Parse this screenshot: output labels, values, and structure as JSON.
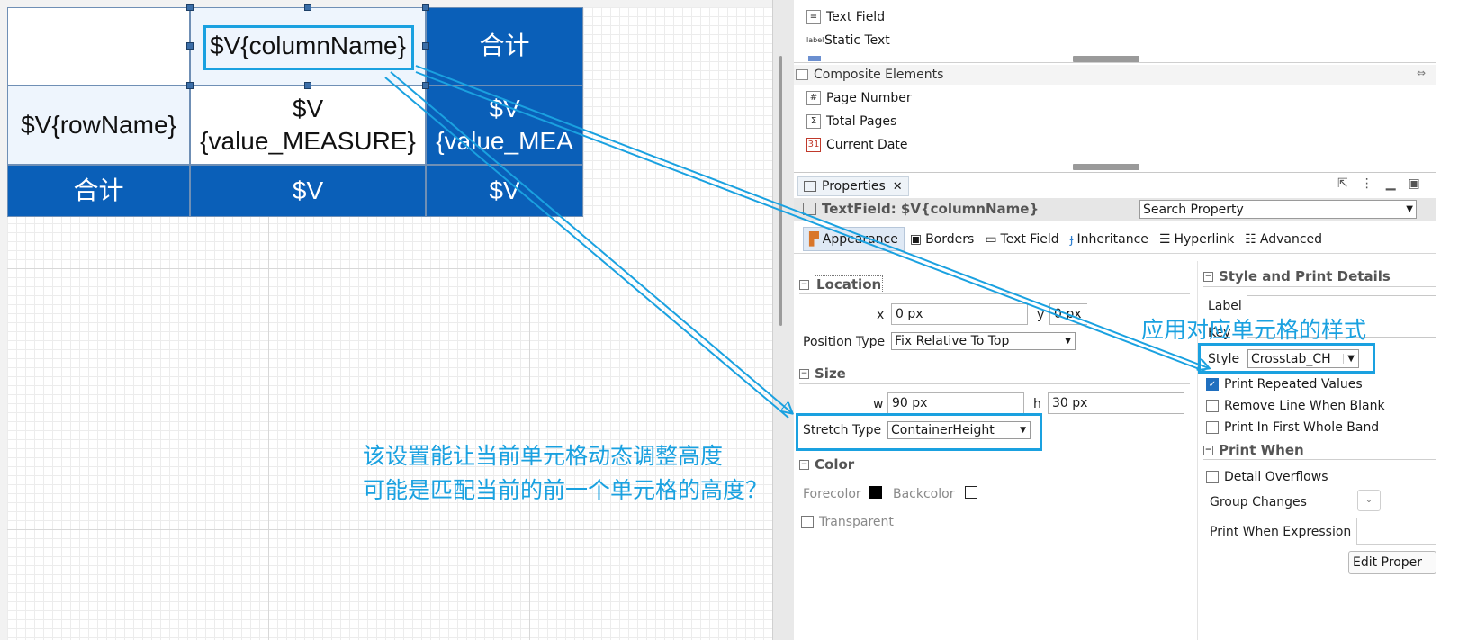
{
  "crosstab": {
    "header_col": "$V{columnName}",
    "header_total": "合计",
    "row_name": "$V{rowName}",
    "measure_line1": "$V",
    "measure_line2": "{value_MEASURE}",
    "measure_total_line1": "$V",
    "measure_total_line2": "{value_MEA",
    "footer_total": "合计",
    "footer_v1": "$V",
    "footer_v2": "$V"
  },
  "palette": {
    "items_top": [
      {
        "icon": "text-field-icon",
        "label": "Text Field"
      },
      {
        "icon": "static-text-icon",
        "label": "Static Text"
      }
    ],
    "group": "Composite Elements",
    "items": [
      {
        "icon": "page-number-icon",
        "label": "Page Number"
      },
      {
        "icon": "total-pages-icon",
        "label": "Total Pages"
      },
      {
        "icon": "calendar-icon",
        "label": "Current Date"
      }
    ]
  },
  "properties": {
    "tab": "Properties",
    "title": "TextField: $V{columnName}",
    "search_placeholder": "Search Property",
    "subtabs": [
      "Appearance",
      "Borders",
      "Text Field",
      "Inheritance",
      "Hyperlink",
      "Advanced"
    ],
    "location": {
      "title": "Location",
      "x_label": "x",
      "x_value": "0 px",
      "y_label": "y",
      "y_value": "0 px",
      "position_type_label": "Position Type",
      "position_type": "Fix Relative To Top"
    },
    "size": {
      "title": "Size",
      "w_label": "w",
      "w_value": "90 px",
      "h_label": "h",
      "h_value": "30 px",
      "stretch_label": "Stretch Type",
      "stretch_value": "ContainerHeight"
    },
    "color": {
      "title": "Color",
      "forecolor_label": "Forecolor",
      "forecolor": "#000000",
      "backcolor_label": "Backcolor",
      "backcolor": "#ffffff",
      "transparent_label": "Transparent"
    },
    "style_print": {
      "title": "Style and Print Details",
      "label_label": "Label",
      "key_label": "Key",
      "style_label": "Style",
      "style_value": "Crosstab_CH",
      "print_repeated": "Print Repeated Values",
      "remove_line": "Remove Line When Blank",
      "print_first": "Print In First Whole Band"
    },
    "print_when": {
      "title": "Print When",
      "detail_overflows": "Detail Overflows",
      "group_changes": "Group Changes",
      "expression": "Print When Expression",
      "edit_button": "Edit Proper"
    }
  },
  "annotations": {
    "right_note": "应用对应单元格的样式",
    "left_note_1": "该设置能让当前单元格动态调整高度",
    "left_note_2": "可能是匹配当前的前一个单元格的高度？"
  },
  "colors": {
    "accent": "#1aa1e0",
    "crosstab_blue": "#0a5fb8"
  }
}
